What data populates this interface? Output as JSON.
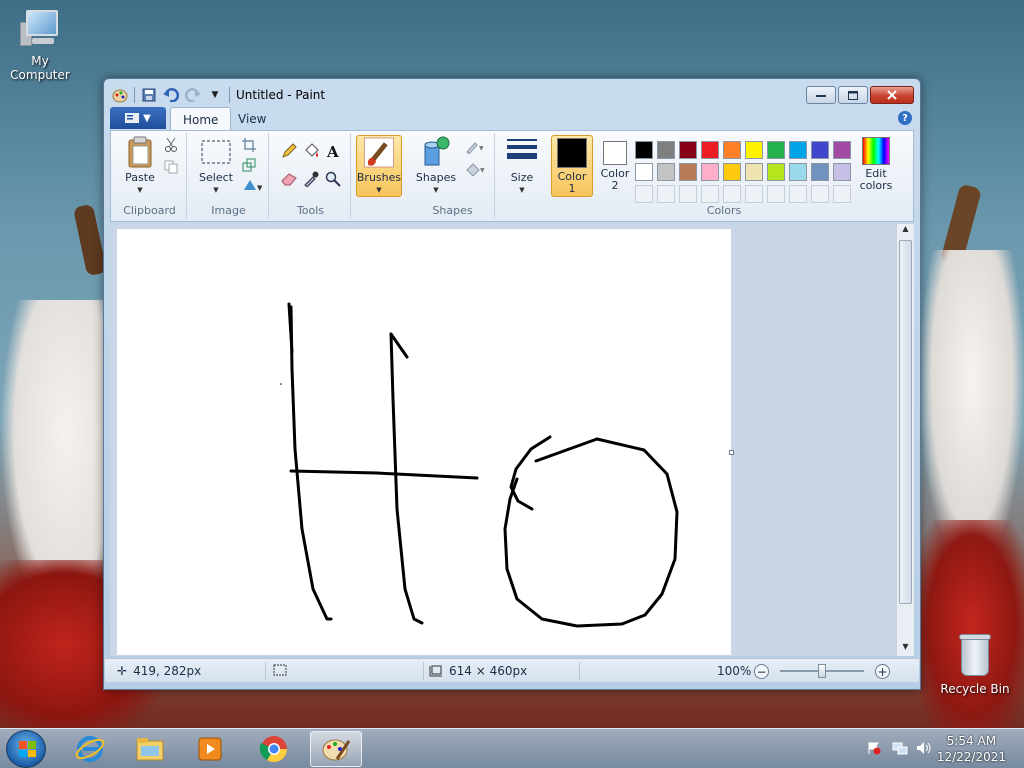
{
  "desktop": {
    "icons": [
      {
        "label": "My Computer"
      },
      {
        "label": "Recycle Bin"
      }
    ]
  },
  "window": {
    "title": "Untitled - Paint",
    "controls": {
      "minimize": "▭",
      "maximize": "▭",
      "close": "✕"
    },
    "tabs": [
      {
        "label": "Home",
        "active": true
      },
      {
        "label": "View",
        "active": false
      }
    ],
    "help_icon": "?"
  },
  "ribbon": {
    "groups": {
      "clipboard": {
        "label": "Clipboard",
        "paste": "Paste"
      },
      "image": {
        "label": "Image",
        "select": "Select"
      },
      "tools": {
        "label": "Tools"
      },
      "brushes": {
        "label": "Brushes"
      },
      "shapes": {
        "label": "Shapes",
        "shapes_btn": "Shapes"
      },
      "size": {
        "label": "Size"
      },
      "colors": {
        "label": "Colors",
        "color1_line1": "Color",
        "color1_line2": "1",
        "color2_line1": "Color",
        "color2_line2": "2",
        "edit_line1": "Edit",
        "edit_line2": "colors",
        "color1_value": "#000000",
        "color2_value": "#ffffff",
        "palette_row1": [
          "#000000",
          "#7f7f7f",
          "#880015",
          "#ed1c24",
          "#ff7f27",
          "#fff200",
          "#22b14c",
          "#00a2e8",
          "#3f48cc",
          "#a349a4"
        ],
        "palette_row2": [
          "#ffffff",
          "#c3c3c3",
          "#b97a57",
          "#ffaec9",
          "#ffc90e",
          "#efe4b0",
          "#b5e61d",
          "#99d9ea",
          "#7092be",
          "#c8bfe7"
        ]
      }
    }
  },
  "statusbar": {
    "cursor_pos": "419, 282px",
    "image_size": "614 × 460px",
    "zoom": "100%"
  },
  "taskbar": {
    "time": "5:54 AM",
    "date": "12/22/2021"
  }
}
